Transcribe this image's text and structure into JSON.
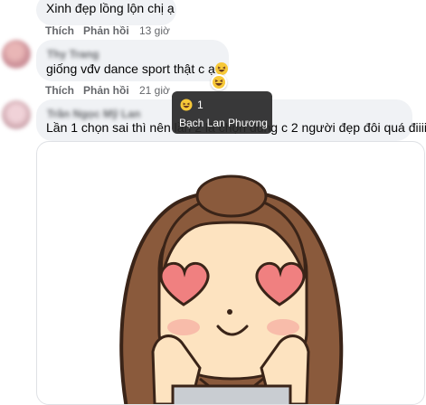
{
  "comments": [
    {
      "text": "Xinh đẹp lồng lộn chị ạ",
      "like_label": "Thích",
      "reply_label": "Phản hồi",
      "time": "13 giờ"
    },
    {
      "author": "Thy Trang",
      "text": "giống vđv dance sport thật c ạ",
      "like_label": "Thích",
      "reply_label": "Phản hồi",
      "time": "21 giờ"
    },
    {
      "author": "Trần Ngọc Mỹ Lan",
      "text": "Lần 1 chọn sai thì nên lần 2 là chọn đúng c 2 người đẹp đôi quá điiii"
    }
  ],
  "reaction_tooltip": {
    "icon": "haha-emoji-icon",
    "count": "1",
    "names": "Bạch Lan Phương"
  },
  "sticker": {
    "icon": "heart-eyes-girl-sticker"
  },
  "colors": {
    "bubble_bg": "#f0f2f5",
    "secondary_text": "#65676b",
    "tooltip_bg": "#282828",
    "emoji_yellow": "#f7c838",
    "heart": "#f08080",
    "hair": "#8a5a3c"
  }
}
